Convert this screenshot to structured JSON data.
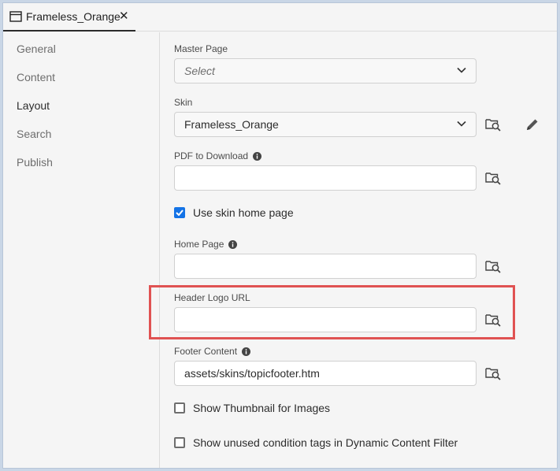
{
  "tab": {
    "title": "Frameless_Orange",
    "close": "✕"
  },
  "sidebar": {
    "items": [
      {
        "label": "General",
        "active": false
      },
      {
        "label": "Content",
        "active": false
      },
      {
        "label": "Layout",
        "active": true
      },
      {
        "label": "Search",
        "active": false
      },
      {
        "label": "Publish",
        "active": false
      }
    ]
  },
  "form": {
    "master_page": {
      "label": "Master Page",
      "value": "",
      "placeholder": "Select"
    },
    "skin": {
      "label": "Skin",
      "value": "Frameless_Orange"
    },
    "pdf_to_download": {
      "label": "PDF to Download",
      "value": ""
    },
    "use_skin_home_page": {
      "label": "Use skin home page",
      "checked": true
    },
    "home_page": {
      "label": "Home Page",
      "value": ""
    },
    "header_logo_url": {
      "label": "Header Logo URL",
      "value": ""
    },
    "footer_content": {
      "label": "Footer Content",
      "value": "assets/skins/topicfooter.htm"
    },
    "show_thumbnail": {
      "label": "Show Thumbnail for Images",
      "checked": false
    },
    "show_unused_tags": {
      "label": "Show unused condition tags in Dynamic Content Filter",
      "checked": false
    }
  },
  "colors": {
    "accent": "#1473e6",
    "highlight": "#e05252"
  }
}
